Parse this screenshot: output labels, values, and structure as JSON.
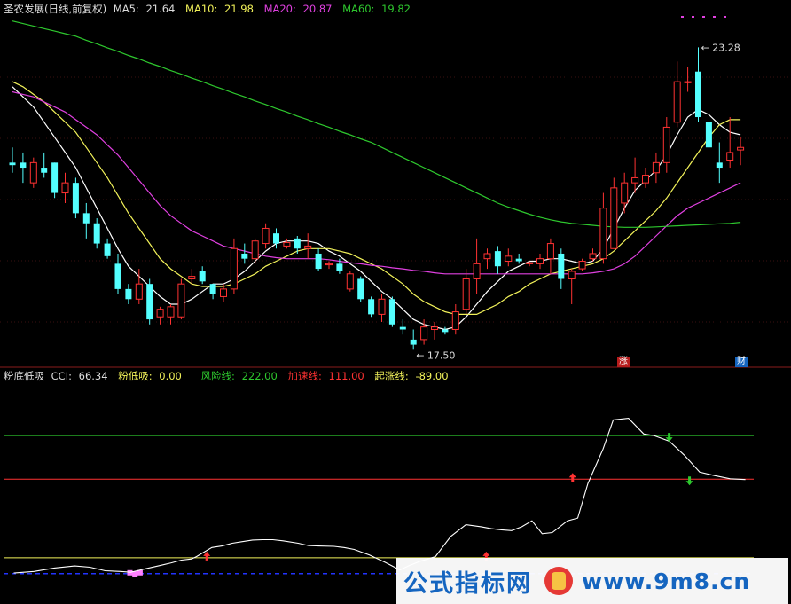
{
  "top_legend": {
    "name": "圣农发展(日线,前复权)",
    "ma5_label": "MA5:",
    "ma5_value": "21.64",
    "ma5_color": "#ffffff",
    "ma10_label": "MA10:",
    "ma10_value": "21.98",
    "ma10_color": "#f2f25a",
    "ma20_label": "MA20:",
    "ma20_value": "20.87",
    "ma20_color": "#e040e0",
    "ma60_label": "MA60:",
    "ma60_value": "19.82",
    "ma60_color": "#2ec82e"
  },
  "bottom_legend": {
    "name": "粉底低吸",
    "cci_label": "CCI:",
    "cci_value": "66.34",
    "fen_label": "粉低吸:",
    "fen_value": "0.00",
    "risk_label": "风险线:",
    "risk_value": "222.00",
    "accel_label": "加速线:",
    "accel_value": "111.00",
    "start_label": "起涨线:",
    "start_value": "-89.00"
  },
  "annotations": {
    "high_label": "23.28",
    "low_label": "17.50"
  },
  "badges": {
    "zhang": "涨",
    "cai": "财"
  },
  "watermark": {
    "left_text": "公式指标网",
    "right_text": "www.9m8.cn"
  },
  "colors": {
    "up": "#ff3232",
    "down": "#54ffff",
    "risk": "#2ec82e",
    "accel": "#ff3232",
    "start": "#f2f25a",
    "cci": "#ffffff",
    "fen": "#ff80ff"
  },
  "chart_data": [
    {
      "type": "candlestick",
      "ylim": [
        17.2,
        23.9
      ],
      "candles": [
        {
          "o": 21.0,
          "h": 21.3,
          "l": 20.8,
          "c": 20.95
        },
        {
          "o": 21.0,
          "h": 21.2,
          "l": 20.6,
          "c": 20.9
        },
        {
          "o": 20.6,
          "h": 21.1,
          "l": 20.5,
          "c": 21.0
        },
        {
          "o": 20.9,
          "h": 21.2,
          "l": 20.7,
          "c": 20.8
        },
        {
          "o": 21.0,
          "h": 21.0,
          "l": 20.3,
          "c": 20.4
        },
        {
          "o": 20.4,
          "h": 20.8,
          "l": 20.2,
          "c": 20.6
        },
        {
          "o": 20.6,
          "h": 20.7,
          "l": 19.9,
          "c": 20.0
        },
        {
          "o": 20.0,
          "h": 20.2,
          "l": 19.5,
          "c": 19.8
        },
        {
          "o": 19.8,
          "h": 19.9,
          "l": 19.3,
          "c": 19.4
        },
        {
          "o": 19.4,
          "h": 19.5,
          "l": 19.1,
          "c": 19.15
        },
        {
          "o": 19.0,
          "h": 19.2,
          "l": 18.4,
          "c": 18.5
        },
        {
          "o": 18.5,
          "h": 18.6,
          "l": 18.2,
          "c": 18.3
        },
        {
          "o": 18.3,
          "h": 18.9,
          "l": 18.2,
          "c": 18.6
        },
        {
          "o": 18.6,
          "h": 18.7,
          "l": 17.8,
          "c": 17.9
        },
        {
          "o": 17.95,
          "h": 18.15,
          "l": 17.8,
          "c": 18.1
        },
        {
          "o": 17.95,
          "h": 18.2,
          "l": 17.8,
          "c": 18.15
        },
        {
          "o": 17.95,
          "h": 18.7,
          "l": 17.9,
          "c": 18.6
        },
        {
          "o": 18.7,
          "h": 18.9,
          "l": 18.6,
          "c": 18.75
        },
        {
          "o": 18.85,
          "h": 18.95,
          "l": 18.6,
          "c": 18.65
        },
        {
          "o": 18.6,
          "h": 18.6,
          "l": 18.3,
          "c": 18.4
        },
        {
          "o": 18.35,
          "h": 18.6,
          "l": 18.25,
          "c": 18.5
        },
        {
          "o": 18.5,
          "h": 19.5,
          "l": 18.4,
          "c": 19.3
        },
        {
          "o": 19.2,
          "h": 19.4,
          "l": 19.0,
          "c": 19.1
        },
        {
          "o": 19.1,
          "h": 19.5,
          "l": 19.0,
          "c": 19.45
        },
        {
          "o": 19.4,
          "h": 19.8,
          "l": 19.3,
          "c": 19.7
        },
        {
          "o": 19.6,
          "h": 19.7,
          "l": 19.3,
          "c": 19.4
        },
        {
          "o": 19.35,
          "h": 19.5,
          "l": 19.3,
          "c": 19.42
        },
        {
          "o": 19.5,
          "h": 19.55,
          "l": 19.2,
          "c": 19.3
        },
        {
          "o": 19.3,
          "h": 19.6,
          "l": 19.1,
          "c": 19.35
        },
        {
          "o": 19.2,
          "h": 19.3,
          "l": 18.85,
          "c": 18.9
        },
        {
          "o": 19.0,
          "h": 19.05,
          "l": 18.9,
          "c": 19.0
        },
        {
          "o": 19.0,
          "h": 19.1,
          "l": 18.8,
          "c": 18.85
        },
        {
          "o": 18.5,
          "h": 18.85,
          "l": 18.45,
          "c": 18.8
        },
        {
          "o": 18.7,
          "h": 18.75,
          "l": 18.25,
          "c": 18.3
        },
        {
          "o": 18.3,
          "h": 18.35,
          "l": 17.95,
          "c": 18.0
        },
        {
          "o": 18.0,
          "h": 18.4,
          "l": 17.85,
          "c": 18.3
        },
        {
          "o": 18.3,
          "h": 18.35,
          "l": 17.75,
          "c": 17.8
        },
        {
          "o": 17.75,
          "h": 17.9,
          "l": 17.6,
          "c": 17.7
        },
        {
          "o": 17.5,
          "h": 17.7,
          "l": 17.3,
          "c": 17.4
        },
        {
          "o": 17.5,
          "h": 17.9,
          "l": 17.4,
          "c": 17.75
        },
        {
          "o": 17.7,
          "h": 17.85,
          "l": 17.5,
          "c": 17.75
        },
        {
          "o": 17.7,
          "h": 17.75,
          "l": 17.6,
          "c": 17.65
        },
        {
          "o": 17.7,
          "h": 18.2,
          "l": 17.6,
          "c": 18.05
        },
        {
          "o": 18.1,
          "h": 18.9,
          "l": 18.0,
          "c": 18.7
        },
        {
          "o": 18.7,
          "h": 19.5,
          "l": 18.4,
          "c": 19.0
        },
        {
          "o": 19.1,
          "h": 19.3,
          "l": 18.9,
          "c": 19.2
        },
        {
          "o": 19.25,
          "h": 19.35,
          "l": 18.8,
          "c": 18.95
        },
        {
          "o": 19.05,
          "h": 19.3,
          "l": 18.95,
          "c": 19.15
        },
        {
          "o": 19.1,
          "h": 19.2,
          "l": 19.0,
          "c": 19.05
        },
        {
          "o": 19.0,
          "h": 19.05,
          "l": 18.95,
          "c": 19.02
        },
        {
          "o": 19.0,
          "h": 19.2,
          "l": 18.9,
          "c": 19.1
        },
        {
          "o": 19.1,
          "h": 19.5,
          "l": 18.8,
          "c": 19.4
        },
        {
          "o": 19.2,
          "h": 19.3,
          "l": 18.5,
          "c": 18.7
        },
        {
          "o": 18.7,
          "h": 18.9,
          "l": 18.2,
          "c": 18.85
        },
        {
          "o": 18.9,
          "h": 19.1,
          "l": 18.85,
          "c": 19.05
        },
        {
          "o": 19.1,
          "h": 19.3,
          "l": 19.05,
          "c": 19.2
        },
        {
          "o": 19.1,
          "h": 20.4,
          "l": 19.0,
          "c": 20.1
        },
        {
          "o": 19.3,
          "h": 20.7,
          "l": 19.3,
          "c": 20.5
        },
        {
          "o": 20.2,
          "h": 20.8,
          "l": 20.0,
          "c": 20.6
        },
        {
          "o": 20.6,
          "h": 21.1,
          "l": 20.4,
          "c": 20.7
        },
        {
          "o": 20.6,
          "h": 20.9,
          "l": 20.5,
          "c": 20.75
        },
        {
          "o": 20.8,
          "h": 21.2,
          "l": 20.6,
          "c": 21.0
        },
        {
          "o": 21.0,
          "h": 21.9,
          "l": 20.8,
          "c": 21.7
        },
        {
          "o": 21.8,
          "h": 23.0,
          "l": 21.7,
          "c": 22.6
        },
        {
          "o": 22.6,
          "h": 22.9,
          "l": 22.4,
          "c": 22.6
        },
        {
          "o": 22.8,
          "h": 23.28,
          "l": 21.8,
          "c": 21.9
        },
        {
          "o": 21.8,
          "h": 21.8,
          "l": 21.3,
          "c": 21.3
        },
        {
          "o": 21.0,
          "h": 21.4,
          "l": 20.6,
          "c": 20.9
        },
        {
          "o": 21.05,
          "h": 21.9,
          "l": 20.9,
          "c": 21.2
        },
        {
          "o": 21.25,
          "h": 21.5,
          "l": 20.95,
          "c": 21.3
        }
      ],
      "ma": [
        {
          "name": "MA5",
          "values": [
            22.5,
            22.3,
            22.1,
            21.8,
            21.5,
            21.2,
            20.9,
            20.5,
            20.1,
            19.7,
            19.3,
            18.95,
            18.75,
            18.55,
            18.35,
            18.2,
            18.2,
            18.3,
            18.45,
            18.6,
            18.6,
            18.7,
            18.85,
            19.05,
            19.25,
            19.4,
            19.45,
            19.45,
            19.45,
            19.4,
            19.25,
            19.15,
            19.0,
            18.85,
            18.65,
            18.45,
            18.3,
            18.1,
            17.9,
            17.8,
            17.75,
            17.7,
            17.75,
            17.95,
            18.2,
            18.45,
            18.65,
            18.85,
            18.95,
            19.05,
            19.05,
            19.1,
            19.1,
            19.05,
            19.0,
            19.05,
            19.3,
            19.7,
            20.1,
            20.45,
            20.65,
            20.85,
            21.15,
            21.55,
            21.9,
            22.05,
            21.95,
            21.75,
            21.6,
            21.55
          ]
        },
        {
          "name": "MA10",
          "values": [
            22.6,
            22.5,
            22.35,
            22.2,
            22.0,
            21.8,
            21.6,
            21.3,
            21.0,
            20.7,
            20.35,
            20.0,
            19.7,
            19.4,
            19.1,
            18.9,
            18.75,
            18.6,
            18.55,
            18.55,
            18.55,
            18.6,
            18.7,
            18.8,
            18.95,
            19.05,
            19.15,
            19.25,
            19.3,
            19.3,
            19.3,
            19.25,
            19.2,
            19.1,
            19.0,
            18.9,
            18.75,
            18.6,
            18.4,
            18.25,
            18.15,
            18.05,
            18.0,
            18.0,
            18.0,
            18.1,
            18.2,
            18.35,
            18.45,
            18.6,
            18.7,
            18.8,
            18.85,
            18.9,
            18.95,
            19.0,
            19.1,
            19.25,
            19.45,
            19.65,
            19.85,
            20.05,
            20.3,
            20.6,
            20.9,
            21.2,
            21.5,
            21.75,
            21.85,
            21.85
          ]
        },
        {
          "name": "MA20",
          "values": [
            22.4,
            22.35,
            22.3,
            22.2,
            22.1,
            22.0,
            21.85,
            21.7,
            21.55,
            21.35,
            21.15,
            20.9,
            20.65,
            20.4,
            20.15,
            19.95,
            19.8,
            19.65,
            19.55,
            19.45,
            19.35,
            19.3,
            19.25,
            19.2,
            19.15,
            19.12,
            19.1,
            19.1,
            19.1,
            19.1,
            19.08,
            19.05,
            19.02,
            19.0,
            18.97,
            18.95,
            18.92,
            18.9,
            18.87,
            18.85,
            18.82,
            18.8,
            18.8,
            18.8,
            18.8,
            18.8,
            18.8,
            18.8,
            18.8,
            18.8,
            18.8,
            18.8,
            18.8,
            18.8,
            18.8,
            18.82,
            18.85,
            18.9,
            19.0,
            19.15,
            19.35,
            19.55,
            19.75,
            19.95,
            20.1,
            20.2,
            20.3,
            20.4,
            20.5,
            20.6
          ]
        },
        {
          "name": "MA60",
          "values": [
            23.8,
            23.75,
            23.7,
            23.65,
            23.6,
            23.55,
            23.5,
            23.42,
            23.35,
            23.27,
            23.2,
            23.12,
            23.05,
            22.97,
            22.9,
            22.82,
            22.75,
            22.67,
            22.6,
            22.52,
            22.45,
            22.37,
            22.3,
            22.22,
            22.15,
            22.07,
            22.0,
            21.92,
            21.85,
            21.77,
            21.7,
            21.62,
            21.55,
            21.47,
            21.4,
            21.3,
            21.2,
            21.1,
            21.0,
            20.9,
            20.8,
            20.7,
            20.6,
            20.5,
            20.4,
            20.3,
            20.2,
            20.12,
            20.05,
            19.98,
            19.92,
            19.87,
            19.83,
            19.8,
            19.78,
            19.76,
            19.74,
            19.73,
            19.72,
            19.72,
            19.72,
            19.73,
            19.74,
            19.75,
            19.76,
            19.77,
            19.78,
            19.79,
            19.8,
            19.82
          ]
        }
      ]
    },
    {
      "type": "line",
      "ylim": [
        -200,
        360
      ],
      "levels": [
        {
          "name": "风险线",
          "value": 222
        },
        {
          "name": "加速线",
          "value": 111
        },
        {
          "name": "起涨线",
          "value": -89
        }
      ],
      "cci_points": [
        [
          2,
          -128
        ],
        [
          6,
          -124
        ],
        [
          10,
          -115
        ],
        [
          14,
          -110
        ],
        [
          17,
          -113
        ],
        [
          20,
          -122
        ],
        [
          23,
          -124
        ],
        [
          25,
          -126
        ],
        [
          26,
          -123
        ],
        [
          28,
          -117
        ],
        [
          31,
          -108
        ],
        [
          33,
          -102
        ],
        [
          35,
          -95
        ],
        [
          37,
          -92
        ],
        [
          38,
          -86
        ],
        [
          39,
          -78
        ],
        [
          41,
          -63
        ],
        [
          43,
          -59
        ],
        [
          45,
          -52
        ],
        [
          47,
          -48
        ],
        [
          49,
          -44
        ],
        [
          51,
          -43
        ],
        [
          53,
          -43
        ],
        [
          55,
          -46
        ],
        [
          58,
          -52
        ],
        [
          60,
          -58
        ],
        [
          62,
          -59
        ],
        [
          65,
          -60
        ],
        [
          67,
          -63
        ],
        [
          69,
          -68
        ],
        [
          72,
          -82
        ],
        [
          75,
          -100
        ],
        [
          78,
          -120
        ],
        [
          80,
          -108
        ],
        [
          82,
          -98
        ],
        [
          85,
          -86
        ],
        [
          88,
          -35
        ],
        [
          91,
          -5
        ],
        [
          94,
          -10
        ],
        [
          96,
          -15
        ],
        [
          98,
          -18
        ],
        [
          100,
          -20
        ],
        [
          102,
          -10
        ],
        [
          104,
          5
        ],
        [
          106,
          -28
        ],
        [
          108,
          -25
        ],
        [
          111,
          5
        ],
        [
          113,
          12
        ],
        [
          115,
          100
        ],
        [
          118,
          188
        ],
        [
          120,
          262
        ],
        [
          123,
          266
        ],
        [
          126,
          226
        ],
        [
          128,
          222
        ],
        [
          131,
          208
        ],
        [
          134,
          172
        ],
        [
          137,
          129
        ],
        [
          140,
          120
        ],
        [
          143,
          112
        ],
        [
          146,
          110
        ]
      ],
      "fen_bars": [
        [
          25,
          -125
        ],
        [
          26,
          -128
        ],
        [
          27,
          -125
        ]
      ],
      "arrows_up": [
        [
          40,
          -89
        ],
        [
          95,
          -89
        ],
        [
          112,
          111
        ]
      ],
      "arrows_down": [
        [
          131,
          222
        ],
        [
          135,
          111
        ]
      ]
    }
  ]
}
